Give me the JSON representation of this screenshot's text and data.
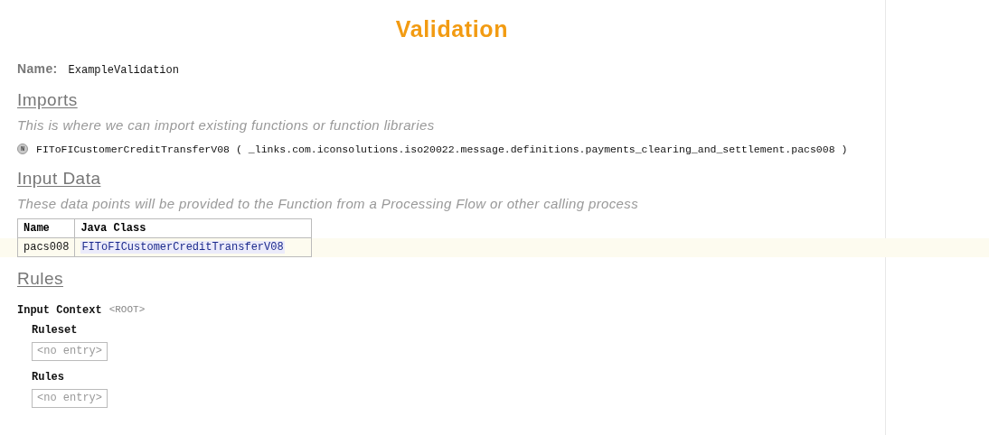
{
  "title": "Validation",
  "name": {
    "label": "Name:",
    "value": "ExampleValidation"
  },
  "imports": {
    "heading": "Imports",
    "description": "This is where we can import existing functions or function libraries",
    "items": [
      {
        "badge": "N",
        "name": "FIToFICustomerCreditTransferV08",
        "open": "(",
        "path": "_links.com.iconsolutions.iso20022.message.definitions.payments_clearing_and_settlement.pacs008",
        "close": ")"
      }
    ]
  },
  "input_data": {
    "heading": "Input Data",
    "description": "These data points will be provided to the Function from a Processing Flow or other calling process",
    "table": {
      "columns": [
        "Name",
        "Java Class"
      ],
      "rows": [
        {
          "cells": [
            "pacs008",
            "FIToFICustomerCreditTransferV08"
          ],
          "selected": true
        }
      ]
    }
  },
  "rules": {
    "heading": "Rules",
    "context_label": "Input Context",
    "context_value": "<ROOT>",
    "groups": [
      {
        "label": "Ruleset",
        "placeholder": "<no entry>"
      },
      {
        "label": "Rules",
        "placeholder": "<no entry>"
      }
    ]
  }
}
